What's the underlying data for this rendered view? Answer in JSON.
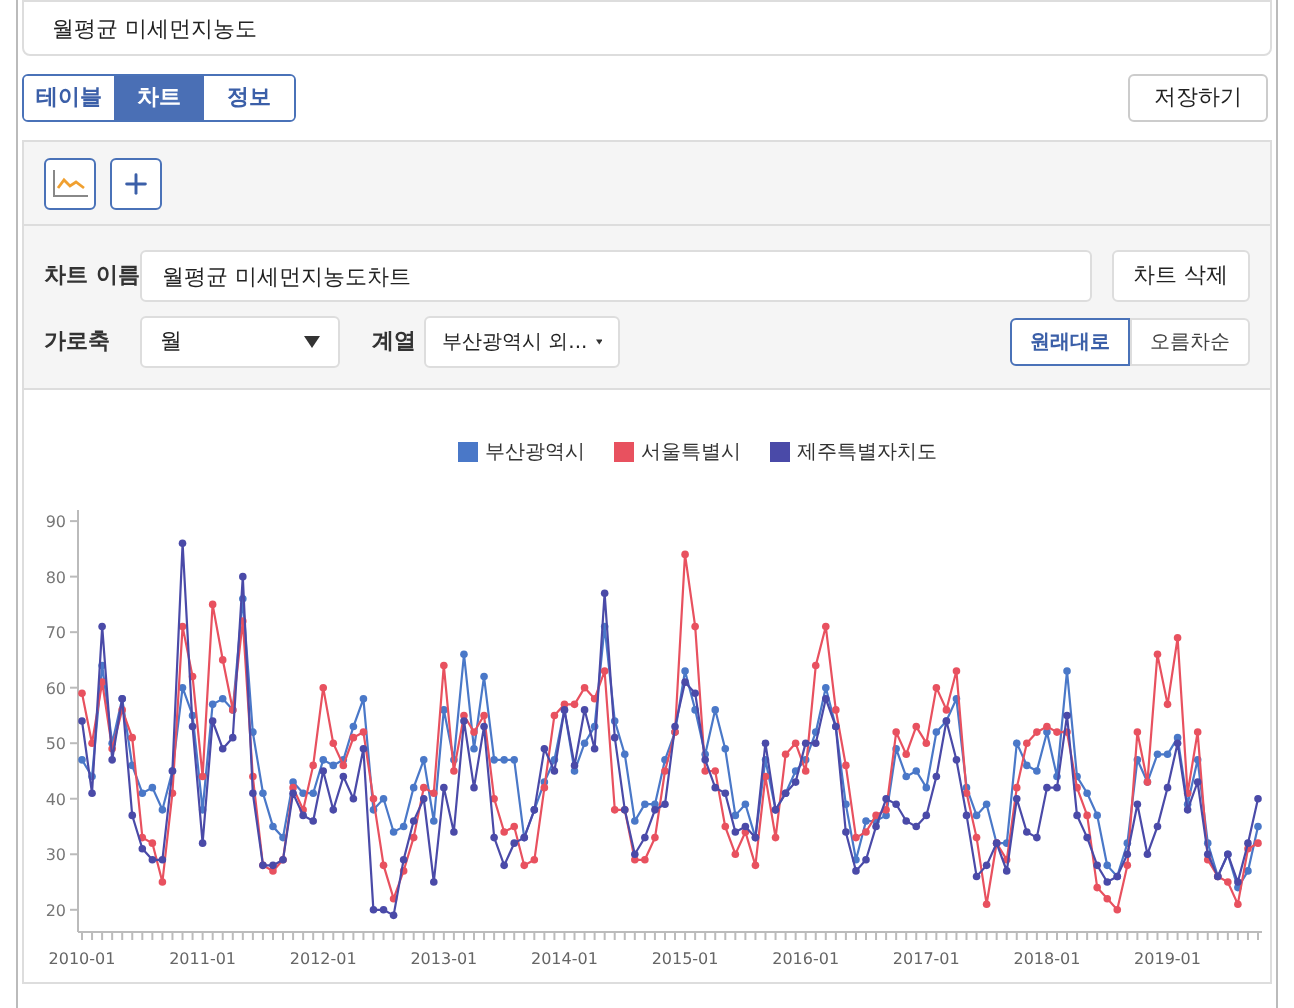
{
  "title_field": {
    "value": "월평균 미세먼지농도"
  },
  "tabs": [
    {
      "label": "테이블",
      "selected": false
    },
    {
      "label": "차트",
      "selected": true
    },
    {
      "label": "정보",
      "selected": false
    }
  ],
  "save_button": "저장하기",
  "chart_name": {
    "label": "차트 이름",
    "value": "월평균 미세먼지농도차트"
  },
  "delete_button": "차트 삭제",
  "x_axis_select": {
    "label": "가로축",
    "value": "월"
  },
  "series_select": {
    "label": "계열",
    "value": "부산광역시 외..."
  },
  "sort_options": [
    {
      "label": "원래대로",
      "selected": true
    },
    {
      "label": "오름차순",
      "selected": false
    }
  ],
  "chart": {
    "chart_data": {
      "type": "line",
      "legend": true,
      "categories": [
        "2010-01",
        null,
        null,
        null,
        null,
        null,
        null,
        null,
        null,
        null,
        null,
        null,
        "2011-01",
        null,
        null,
        null,
        null,
        null,
        null,
        null,
        null,
        null,
        null,
        null,
        "2012-01",
        null,
        null,
        null,
        null,
        null,
        null,
        null,
        null,
        null,
        null,
        null,
        "2013-01",
        null,
        null,
        null,
        null,
        null,
        null,
        null,
        null,
        null,
        null,
        null,
        "2014-01",
        null,
        null,
        null,
        null,
        null,
        null,
        null,
        null,
        null,
        null,
        null,
        "2015-01",
        null,
        null,
        null,
        null,
        null,
        null,
        null,
        null,
        null,
        null,
        null,
        "2016-01",
        null,
        null,
        null,
        null,
        null,
        null,
        null,
        null,
        null,
        null,
        null,
        "2017-01",
        null,
        null,
        null,
        null,
        null,
        null,
        null,
        null,
        null,
        null,
        null,
        "2018-01",
        null,
        null,
        null,
        null,
        null,
        null,
        null,
        null,
        null,
        null,
        null,
        "2019-01",
        null,
        null,
        null,
        null,
        null,
        null,
        null,
        null,
        null
      ],
      "series": [
        {
          "name": "부산광역시",
          "color": "#4a78c8",
          "marker": "circle",
          "values": [
            47,
            44,
            64,
            50,
            58,
            46,
            41,
            42,
            38,
            45,
            60,
            55,
            38,
            57,
            58,
            56,
            76,
            52,
            41,
            35,
            33,
            43,
            41,
            41,
            47,
            46,
            47,
            53,
            58,
            38,
            40,
            34,
            35,
            42,
            47,
            36,
            56,
            47,
            66,
            49,
            62,
            47,
            47,
            47,
            33,
            38,
            43,
            47,
            56,
            45,
            50,
            53,
            71,
            54,
            48,
            36,
            39,
            39,
            47,
            52,
            63,
            56,
            48,
            56,
            49,
            37,
            39,
            33,
            47,
            38,
            41,
            45,
            47,
            52,
            60,
            53,
            39,
            29,
            36,
            36,
            37,
            49,
            44,
            45,
            42,
            52,
            54,
            58,
            42,
            37,
            39,
            32,
            32,
            50,
            46,
            45,
            52,
            44,
            63,
            44,
            41,
            37,
            28,
            26,
            32,
            47,
            43,
            48,
            48,
            51,
            39,
            47,
            32,
            26,
            30,
            24,
            27,
            35
          ]
        },
        {
          "name": "서울특별시",
          "color": "#e8515f",
          "marker": "circle",
          "values": [
            59,
            50,
            61,
            49,
            56,
            51,
            33,
            32,
            25,
            41,
            71,
            62,
            44,
            75,
            65,
            56,
            72,
            44,
            28,
            27,
            29,
            42,
            38,
            46,
            60,
            50,
            46,
            51,
            52,
            40,
            28,
            22,
            27,
            33,
            42,
            41,
            64,
            45,
            55,
            52,
            55,
            40,
            34,
            35,
            28,
            29,
            42,
            55,
            57,
            57,
            60,
            58,
            63,
            38,
            38,
            29,
            29,
            33,
            45,
            52,
            84,
            71,
            45,
            45,
            35,
            30,
            34,
            28,
            44,
            33,
            48,
            50,
            45,
            64,
            71,
            56,
            46,
            33,
            34,
            37,
            38,
            52,
            48,
            53,
            50,
            60,
            56,
            63,
            41,
            33,
            21,
            32,
            29,
            42,
            50,
            52,
            53,
            52,
            52,
            42,
            37,
            24,
            22,
            20,
            28,
            52,
            43,
            66,
            57,
            69,
            41,
            52,
            29,
            26,
            25,
            21,
            31,
            32
          ]
        },
        {
          "name": "제주특별자치도",
          "color": "#4a4aa8",
          "marker": "circle",
          "values": [
            54,
            41,
            71,
            47,
            58,
            37,
            31,
            29,
            29,
            45,
            86,
            53,
            32,
            54,
            49,
            51,
            80,
            41,
            28,
            28,
            29,
            41,
            37,
            36,
            45,
            38,
            44,
            40,
            49,
            20,
            20,
            19,
            29,
            36,
            40,
            25,
            42,
            34,
            54,
            42,
            53,
            33,
            28,
            32,
            33,
            38,
            49,
            45,
            56,
            46,
            56,
            49,
            77,
            51,
            38,
            30,
            33,
            38,
            39,
            53,
            61,
            59,
            47,
            42,
            41,
            34,
            35,
            33,
            50,
            38,
            41,
            43,
            50,
            50,
            58,
            53,
            34,
            27,
            29,
            35,
            40,
            39,
            36,
            35,
            37,
            44,
            54,
            47,
            37,
            26,
            28,
            32,
            27,
            40,
            34,
            33,
            42,
            42,
            55,
            37,
            33,
            28,
            25,
            26,
            30,
            39,
            30,
            35,
            42,
            50,
            38,
            43,
            30,
            26,
            30,
            25,
            32,
            40
          ]
        }
      ],
      "ylim": [
        16,
        92
      ],
      "yticks": [
        20,
        30,
        40,
        50,
        60,
        70,
        80,
        90
      ]
    }
  }
}
